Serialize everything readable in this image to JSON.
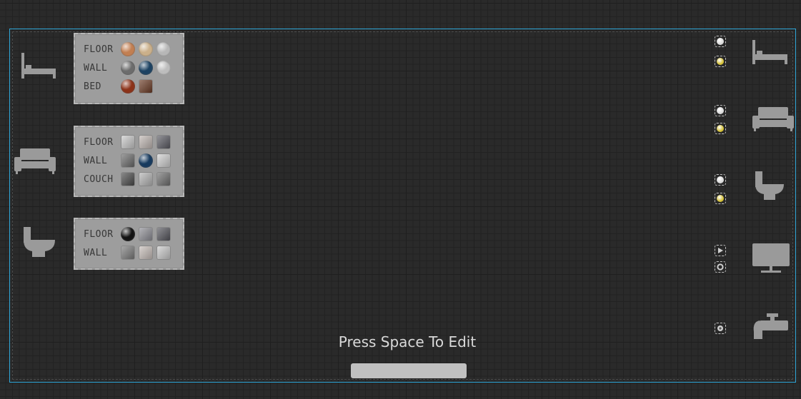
{
  "panels": [
    {
      "rows": [
        {
          "label": "FLOOR",
          "swatches": [
            {
              "shape": "sphere",
              "color": "#c27f52"
            },
            {
              "shape": "sphere",
              "color": "#cbb08a"
            },
            {
              "shape": "sphere",
              "color": "#b7b7b7"
            }
          ]
        },
        {
          "label": "WALL",
          "swatches": [
            {
              "shape": "sphere",
              "color": "#6c6c6c"
            },
            {
              "shape": "sphere",
              "color": "#1c4262"
            },
            {
              "shape": "sphere",
              "color": "#bdbdbd"
            }
          ]
        },
        {
          "label": "BED",
          "swatches": [
            {
              "shape": "sphere",
              "color": "#8c3218"
            },
            {
              "shape": "cube",
              "color": "#6a3a24"
            }
          ]
        }
      ]
    },
    {
      "rows": [
        {
          "label": "FLOOR",
          "swatches": [
            {
              "shape": "cube",
              "color": "#c8c8c8"
            },
            {
              "shape": "cube",
              "color": "#bfb6b2"
            },
            {
              "shape": "cube",
              "color": "#5a5a62"
            }
          ]
        },
        {
          "label": "WALL",
          "swatches": [
            {
              "shape": "cube",
              "color": "#6a6a6a"
            },
            {
              "shape": "sphere",
              "color": "#173a5e"
            },
            {
              "shape": "cube",
              "color": "#cfcfcf"
            }
          ]
        },
        {
          "label": "COUCH",
          "swatches": [
            {
              "shape": "cube",
              "color": "#4a4a4a"
            },
            {
              "shape": "cube",
              "color": "#b4b4b4"
            },
            {
              "shape": "cube",
              "color": "#6e6e6e"
            }
          ]
        }
      ]
    },
    {
      "rows": [
        {
          "label": "FLOOR",
          "swatches": [
            {
              "shape": "sphere",
              "color": "#121212"
            },
            {
              "shape": "cube",
              "color": "#8d8d94"
            },
            {
              "shape": "cube",
              "color": "#55555c"
            }
          ]
        },
        {
          "label": "WALL",
          "swatches": [
            {
              "shape": "cube",
              "color": "#7a7a7a"
            },
            {
              "shape": "cube",
              "color": "#c6bdb8"
            },
            {
              "shape": "cube",
              "color": "#c9c9c9"
            }
          ]
        }
      ]
    }
  ],
  "left_icons": [
    "bed-icon",
    "couch-icon",
    "toilet-icon"
  ],
  "right_icons": [
    "bed-icon",
    "couch-icon",
    "toilet-icon",
    "monitor-icon",
    "faucet-icon"
  ],
  "controls": [
    {
      "name": "room-1-control-a",
      "color": "#d8d8d8"
    },
    {
      "name": "room-1-control-b",
      "color": "#d4c034"
    },
    {
      "name": "room-2-control-a",
      "color": "#d8d8d8"
    },
    {
      "name": "room-2-control-b",
      "color": "#d4c034"
    },
    {
      "name": "room-3-control-a",
      "color": "#d8d8d8"
    },
    {
      "name": "room-3-control-b",
      "color": "#d4c034"
    },
    {
      "name": "play-control",
      "color": "#cfcfcf"
    },
    {
      "name": "cycle-control",
      "color": "#cfcfcf"
    },
    {
      "name": "water-control",
      "color": "#cfcfcf"
    }
  ],
  "hint": "Press Space To Edit",
  "colors": {
    "frame": "#2ea6d8",
    "icon": "#9a9a9a",
    "panel": "#9d9d9d"
  }
}
